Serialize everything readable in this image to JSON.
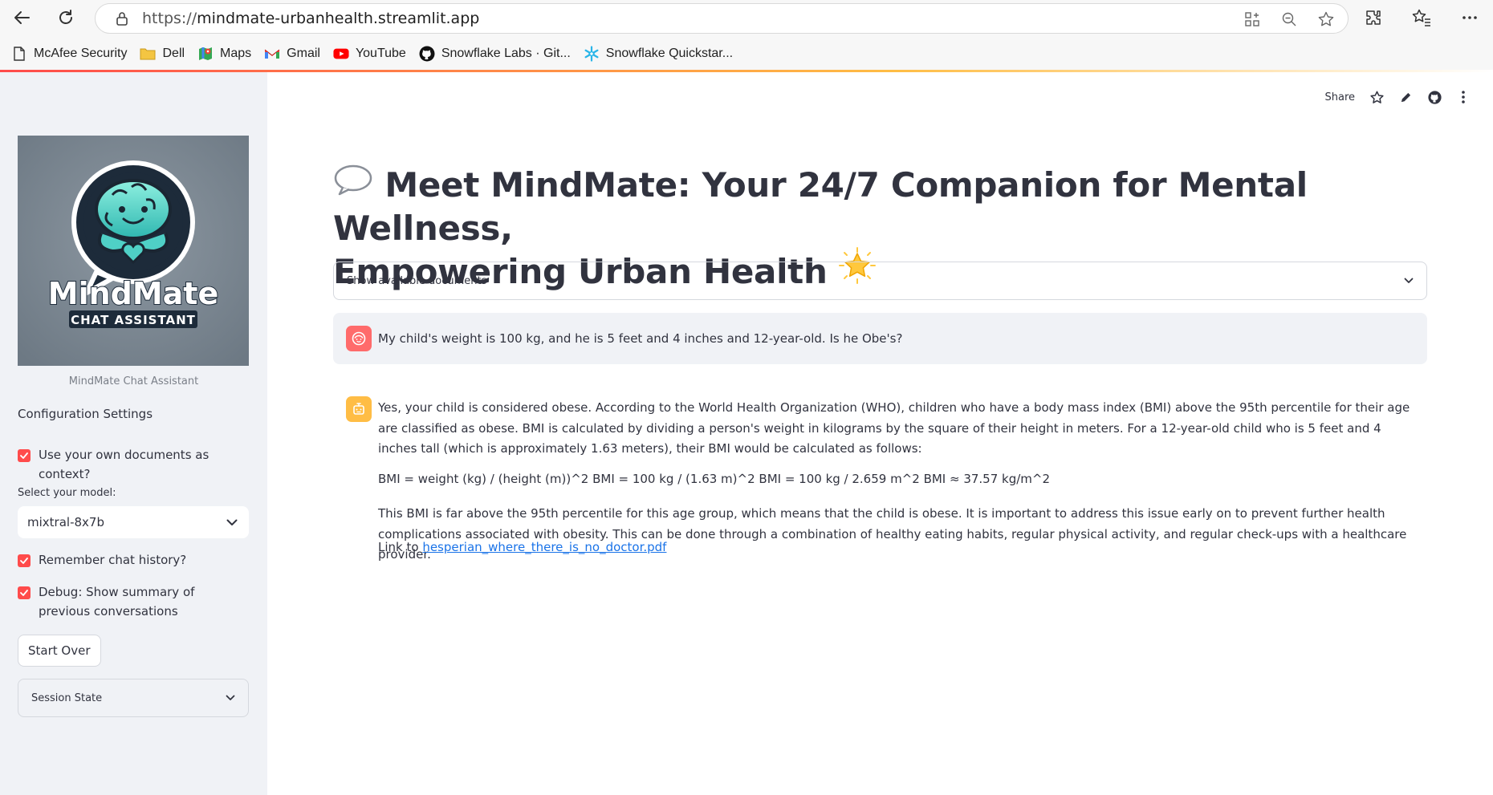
{
  "browser": {
    "url_domain": "mindmate-urbanhealth.streamlit.app",
    "url_scheme": "https://",
    "bookmarks": [
      {
        "label": "McAfee Security",
        "icon": "page-icon"
      },
      {
        "label": "Dell",
        "icon": "folder-icon"
      },
      {
        "label": "Maps",
        "icon": "maps-icon"
      },
      {
        "label": "Gmail",
        "icon": "gmail-icon"
      },
      {
        "label": "YouTube",
        "icon": "youtube-icon"
      },
      {
        "label": "Snowflake Labs · Git...",
        "icon": "github-icon"
      },
      {
        "label": "Snowflake Quickstar...",
        "icon": "snowflake-icon"
      }
    ]
  },
  "sidebar": {
    "logo_text_main": "MindMate",
    "logo_text_sub": "CHAT ASSISTANT",
    "logo_caption": "MindMate Chat Assistant",
    "config_title": "Configuration Settings",
    "use_docs_label": "Use your own documents as context?",
    "model_label": "Select your model:",
    "model_value": "mixtral-8x7b",
    "remember_label": "Remember chat history?",
    "debug_label": "Debug: Show summary of previous conversations",
    "start_over_label": "Start Over",
    "session_state_label": "Session State"
  },
  "toolbar": {
    "share_label": "Share"
  },
  "main": {
    "title_line1": "Meet MindMate: Your 24/7 Companion for Mental Wellness,",
    "title_line2": "Empowering Urban Health",
    "docs_expander_label": "Show available documents",
    "user_message": "My child's weight is 100 kg, and he is 5 feet and 4 inches and 12-year-old. Is he Obe's?",
    "bot_p1": "Yes, your child is considered obese. According to the World Health Organization (WHO), children who have a body mass index (BMI) above the 95th percentile for their age are classified as obese. BMI is calculated by dividing a person's weight in kilograms by the square of their height in meters. For a 12-year-old child who is 5 feet and 4 inches tall (which is approximately 1.63 meters), their BMI would be calculated as follows:",
    "bot_p2": "BMI = weight (kg) / (height (m))^2 BMI = 100 kg / (1.63 m)^2 BMI = 100 kg / 2.659 m^2 BMI ≈ 37.57 kg/m^2",
    "bot_p3": "This BMI is far above the 95th percentile for this age group, which means that the child is obese. It is important to address this issue early on to prevent further health complications associated with obesity. This can be done through a combination of healthy eating habits, regular physical activity, and regular check-ups with a healthcare provider.",
    "bot_link_prefix": "Link to ",
    "bot_link_text": "hesperian_where_there_is_no_doctor.pdf"
  },
  "colors": {
    "accent": "#ff4b4b",
    "sidebar_bg": "#f0f2f6",
    "user_avatar": "#ff6b6b",
    "bot_avatar": "#ffbd45",
    "link": "#1a73e8"
  }
}
